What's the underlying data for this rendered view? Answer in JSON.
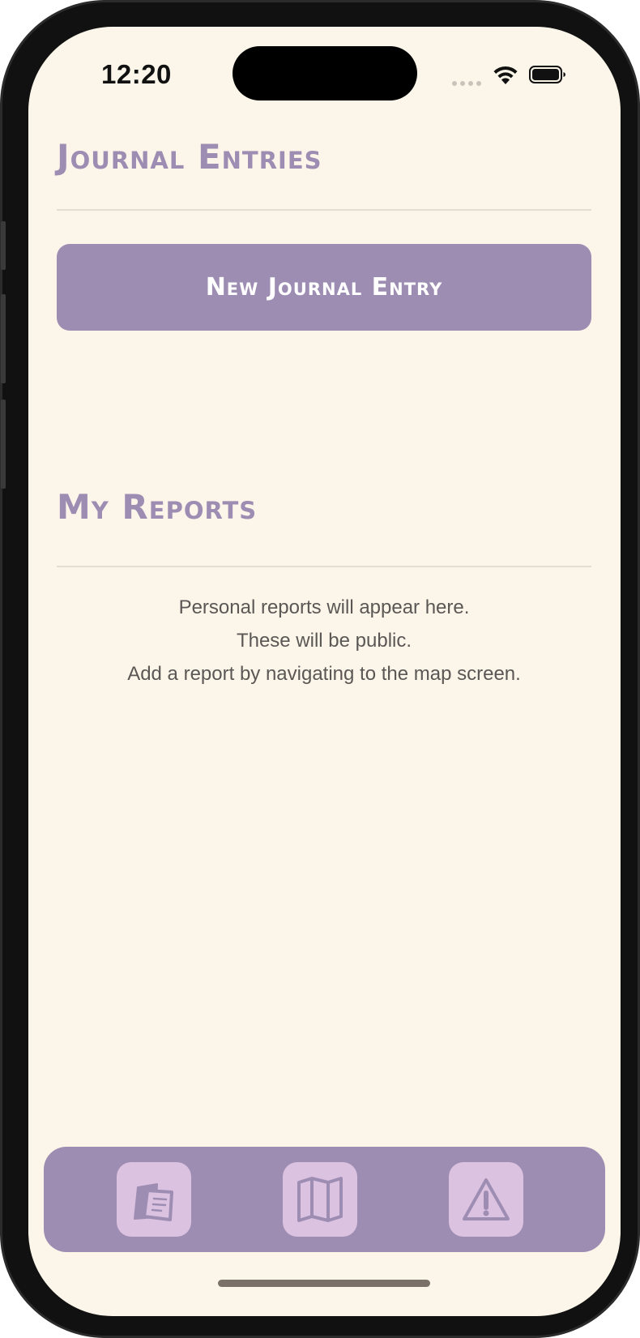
{
  "status_bar": {
    "time": "12:20"
  },
  "journal": {
    "title": "Journal Entries",
    "new_entry_label": "New Journal Entry"
  },
  "reports": {
    "title": "My Reports",
    "empty_lines": [
      "Personal reports will appear here.",
      "These will be public.",
      "Add a report by navigating to the map screen."
    ]
  },
  "tab_bar": {
    "tabs": [
      {
        "icon": "journal-notes-icon"
      },
      {
        "icon": "map-icon"
      },
      {
        "icon": "warning-icon"
      }
    ]
  },
  "colors": {
    "background": "#fbf6e9",
    "accent": "#9e8db3",
    "tab_tile": "#dcc2e1",
    "body_text": "#5b5755"
  }
}
